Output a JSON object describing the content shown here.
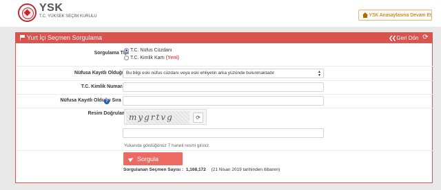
{
  "header": {
    "logo_title": "YSK",
    "logo_subtitle": "T.C. YÜKSEK SEÇİM KURULU",
    "home_button_label": "YSK Anasayfasına Devam Et"
  },
  "panel": {
    "title": "Yurt İçi Seçmen Sorgulama",
    "back_label": "Geri Dön"
  },
  "form": {
    "query_type_label": "Sorgulama Tipi",
    "query_type_options": [
      {
        "label": "T.C. Nüfus Cüzdanı",
        "checked": true,
        "badge": ""
      },
      {
        "label": "T.C. Kimlik Kartı",
        "checked": false,
        "badge": "(Yeni)"
      }
    ],
    "province_label": "Nüfusa Kayıtlı Olduğu İl",
    "province_select_value": "Bu bilgi eski nüfus cüzdanı veya eski ehliyetin arka yüzünde bulunmaktadır",
    "tc_id_label": "T.C. Kimlik Numarası",
    "tc_id_value": "",
    "order_no_label": "Nüfusa Kayıtlı Olduğu Sıra No",
    "order_no_value": "",
    "captcha_label": "Resim Doğrulama",
    "captcha_text": "mygrtvg",
    "captcha_input_value": "",
    "captcha_hint": "Yukarıda gördüğünüz 7 haneli resmi giriniz.",
    "submit_label": "Sorgula"
  },
  "stats": {
    "count_label": "Sorgulanan Seçmen Sayısı :",
    "count_value": "1,168,172",
    "count_note": "(21 Nisan 2019 tarihinden itibaren)"
  },
  "colors": {
    "accent_red": "#d9534f",
    "button_red": "#ec6a62",
    "help_blue": "#2a5db0",
    "home_orange": "#b36b00"
  },
  "icons": {
    "panel_title": "flag-icon",
    "back": "double-chevron-left-icon",
    "reload": "refresh-icon",
    "help": "question-icon",
    "captcha_refresh": "refresh-icon",
    "submit": "send-icon",
    "home": "home-icon"
  }
}
